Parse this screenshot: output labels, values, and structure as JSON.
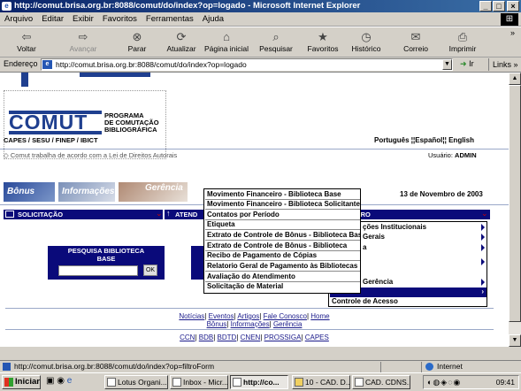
{
  "window": {
    "title": "http://comut.brisa.org.br:8088/comut/do/index?op=logado - Microsoft Internet Explorer"
  },
  "menubar": [
    "Arquivo",
    "Editar",
    "Exibir",
    "Favoritos",
    "Ferramentas",
    "Ajuda"
  ],
  "toolbar": {
    "back": "Voltar",
    "forward": "Avançar",
    "stop": "Parar",
    "refresh": "Atualizar",
    "home": "Página inicial",
    "search": "Pesquisar",
    "favorites": "Favoritos",
    "history": "Histórico",
    "mail": "Correio",
    "print": "Imprimir"
  },
  "address": {
    "label": "Endereço",
    "url": "http://comut.brisa.org.br:8088/comut/do/index?op=logado",
    "go": "Ir",
    "links": "Links"
  },
  "page": {
    "logo_text": "COMUT",
    "program_lines": [
      "PROGRAMA",
      "DE COMUTAÇÃO",
      "BIBLIOGRÁFICA"
    ],
    "partners": "CAPES / SESU / FINEP / IBICT",
    "lang_pt": "Português",
    "lang_es": "Español",
    "lang_en": "English",
    "agreement": "Comut trabalha de acordo com a Lei de Direitos Autorais",
    "user_label": "Usuário:",
    "user_name": "ADMIN",
    "tab_bonus": "Bônus",
    "tab_info": "Informações",
    "tab_gerencia": "Gerência",
    "date": "13 de Novembro de 2003",
    "nav_solicitacao": "SOLICITAÇÃO",
    "nav_atend": "ATEND",
    "nav_registro": "STRO",
    "search_title_1": "PESQUISA BIBLIOTECA",
    "search_title_2": "BASE",
    "ok": "OK"
  },
  "dropdown": [
    "Movimento Financeiro - Biblioteca Base",
    "Movimento Financeiro - Biblioteca Solicitante",
    "Contatos por Período",
    "Etiqueta",
    "Extrato de Controle de Bônus - Biblioteca Base",
    "Extrato de Controle de Bônus - Biblioteca",
    "Recibo de Pagamento de Cópias",
    "Relatorio Geral de Pagamento às Bibliotecas",
    "Avaliação do Atendimento",
    "Solicitação de Material"
  ],
  "right_menu": [
    "ções Institucionais",
    "Gerais",
    "a",
    "",
    "",
    "Gerência",
    "",
    "Controle de Acesso"
  ],
  "footer": {
    "row1": [
      "Notícias",
      "Eventos",
      "Artigos",
      "Fale Conosco",
      "Home"
    ],
    "row2": [
      "Bônus",
      "Informações",
      "Gerência"
    ],
    "row3": [
      "CCN",
      "BDB",
      "BDTD",
      "CNEN",
      "PROSSIGA",
      "CAPES"
    ]
  },
  "status": {
    "url": "http://comut.brisa.org.br:8088/comut/do/index?op=filtroForm",
    "zone": "Internet"
  },
  "taskbar": {
    "start": "Iniciar",
    "tasks": [
      "Lotus Organi...",
      "Inbox - Micr...",
      "http://co...",
      "10 - CAD. D...",
      "CAD. CDNS..."
    ],
    "clock": "09:41"
  },
  "colors": {
    "navy": "#0a0a7a",
    "comut_blue": "#1f3f8f",
    "titlebar": "#0a246a"
  }
}
